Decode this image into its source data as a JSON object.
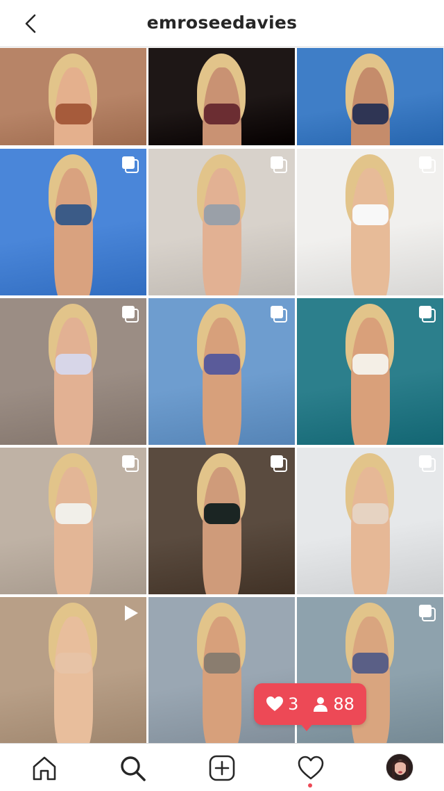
{
  "header": {
    "username": "emroseedavies"
  },
  "grid": {
    "tiles": [
      {
        "badge": "none",
        "bg": "#b78467",
        "accent": "#a65b3b",
        "skin": "#e4b08d"
      },
      {
        "badge": "none",
        "bg": "#1e1716",
        "accent": "#6b2d32",
        "skin": "#c99273"
      },
      {
        "badge": "none",
        "bg": "#3f7ec7",
        "accent": "#2f3554",
        "skin": "#c58c6b"
      },
      {
        "badge": "multi",
        "bg": "#4a86d9",
        "accent": "#3b5b87",
        "skin": "#d9a27f"
      },
      {
        "badge": "multi",
        "bg": "#d8d2cb",
        "accent": "#9aa0a8",
        "skin": "#e2b193"
      },
      {
        "badge": "multi",
        "bg": "#f1f0ee",
        "accent": "#f8f8f8",
        "skin": "#e7bb98"
      },
      {
        "badge": "multi",
        "bg": "#9b8d84",
        "accent": "#d7d6e8",
        "skin": "#e2b193"
      },
      {
        "badge": "multi",
        "bg": "#6e9dcf",
        "accent": "#5a5b9a",
        "skin": "#d7a07b"
      },
      {
        "badge": "multi",
        "bg": "#2c7f8c",
        "accent": "#f4efe6",
        "skin": "#d9a07a"
      },
      {
        "badge": "multi",
        "bg": "#bfb2a5",
        "accent": "#f1efe9",
        "skin": "#e3b696"
      },
      {
        "badge": "multi",
        "bg": "#5a4b3f",
        "accent": "#1b2523",
        "skin": "#cf9b7a"
      },
      {
        "badge": "multi",
        "bg": "#e6e8ea",
        "accent": "#e6d3c2",
        "skin": "#e6b896"
      },
      {
        "badge": "video",
        "bg": "#b89f87",
        "accent": "#e7c3a6",
        "skin": "#e8be9c"
      },
      {
        "badge": "none",
        "bg": "#9aa7b3",
        "accent": "#8a7d6f",
        "skin": "#d7a07b"
      },
      {
        "badge": "multi",
        "bg": "#8ea2ad",
        "accent": "#5a5f86",
        "skin": "#d9a57f"
      }
    ]
  },
  "notification": {
    "likes": "3",
    "followers": "88",
    "color": "#ed4956"
  },
  "tabs": [
    {
      "name": "home-icon"
    },
    {
      "name": "search-icon"
    },
    {
      "name": "new-post-icon"
    },
    {
      "name": "activity-heart-icon"
    },
    {
      "name": "profile-avatar"
    }
  ]
}
